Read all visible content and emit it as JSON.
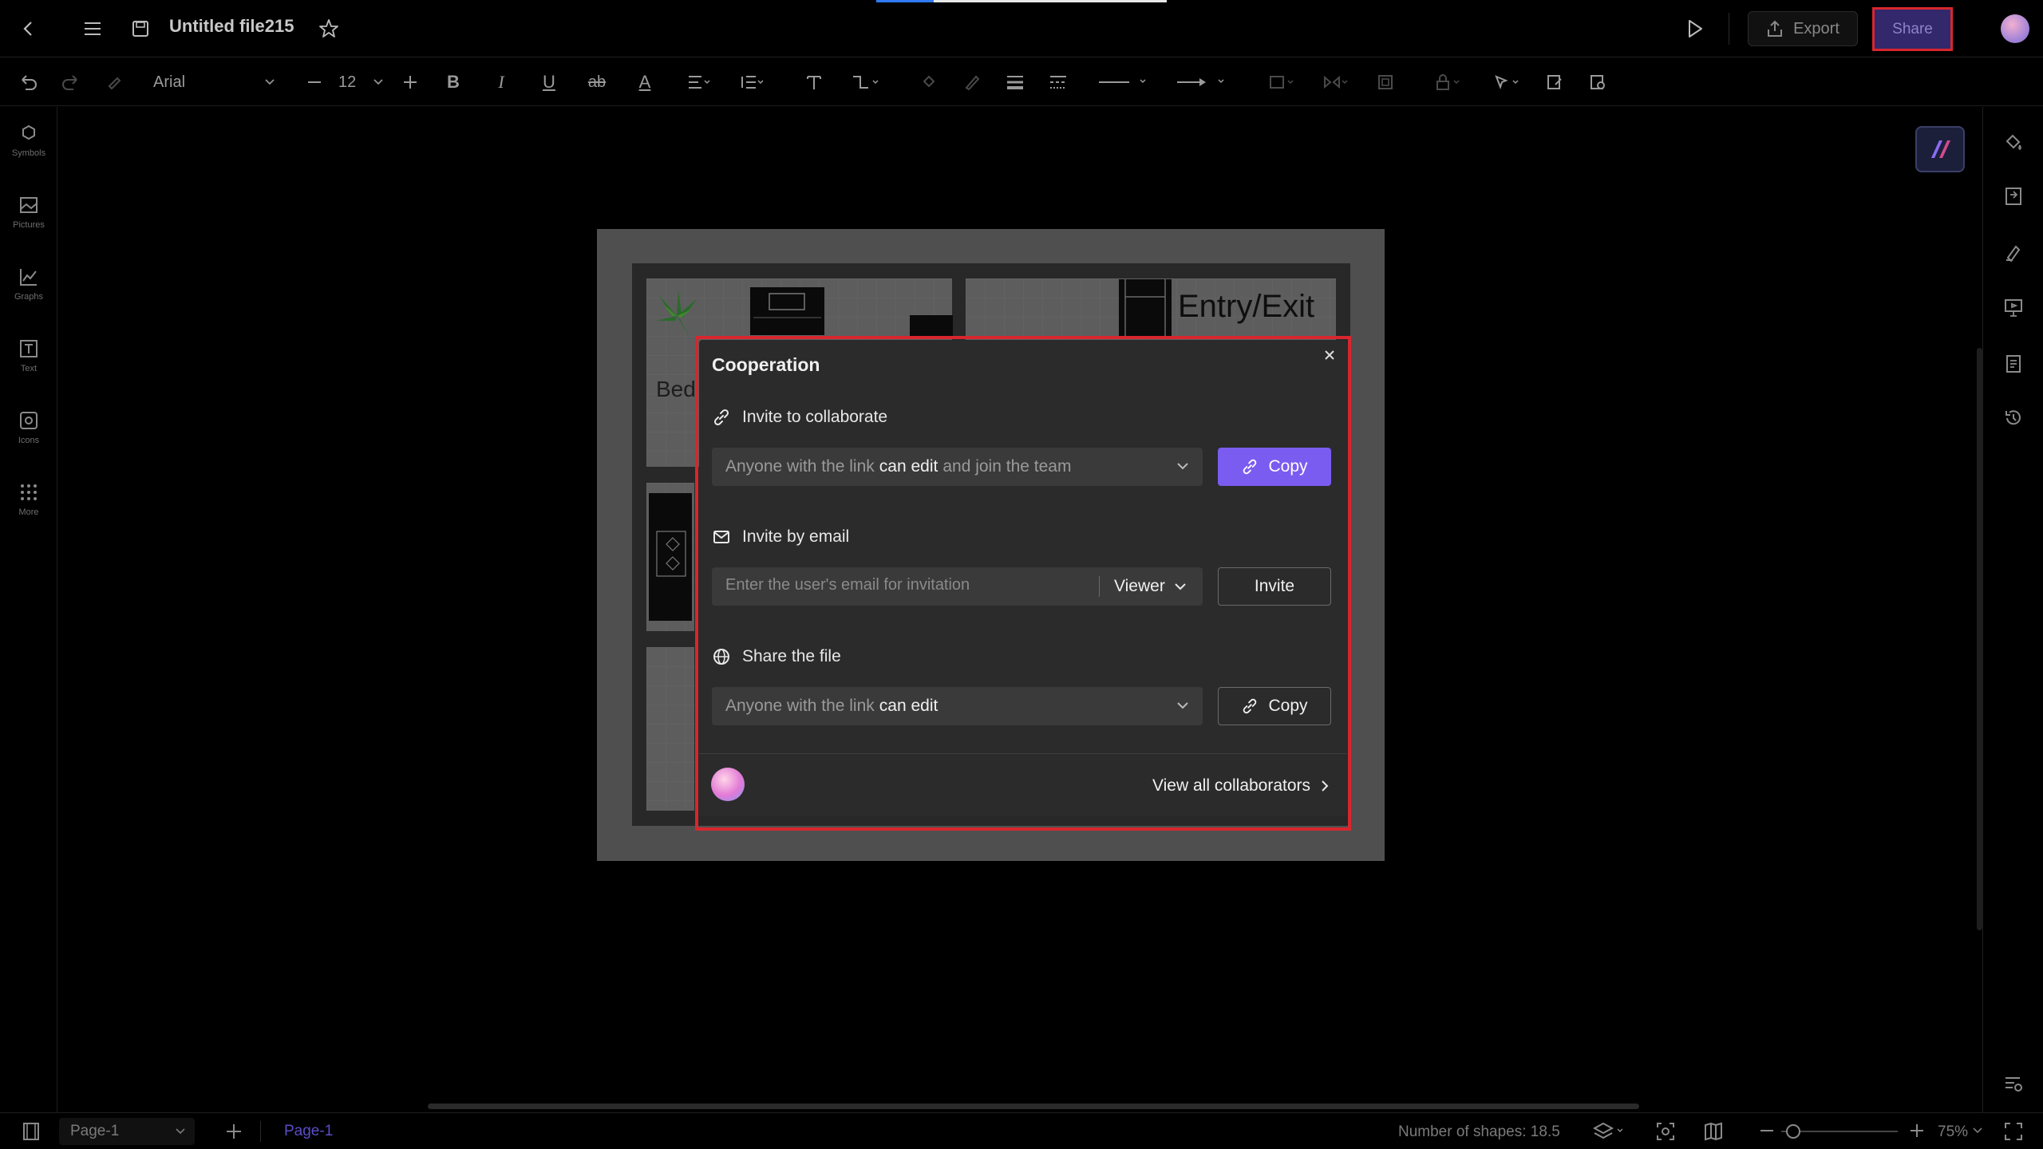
{
  "topbar": {
    "file_title": "Untitled file215",
    "export_label": "Export",
    "share_label": "Share"
  },
  "toolbar": {
    "font_family": "Arial",
    "font_size": "12",
    "strike_label": "ab"
  },
  "left_sidebar": {
    "items": [
      {
        "label": "Symbols",
        "icon": "symbols-icon"
      },
      {
        "label": "Pictures",
        "icon": "pictures-icon"
      },
      {
        "label": "Graphs",
        "icon": "graphs-icon"
      },
      {
        "label": "Text",
        "icon": "text-icon"
      },
      {
        "label": "Icons",
        "icon": "icons-icon"
      },
      {
        "label": "More",
        "icon": "more-grid-icon"
      }
    ]
  },
  "canvas": {
    "entry_exit_label": "Entry/Exit",
    "bed_label": "Bed"
  },
  "dialog": {
    "title": "Cooperation",
    "invite_collab": {
      "heading": "Invite to collaborate",
      "select_prefix": "Anyone with the link",
      "select_strong": "can edit",
      "select_suffix": "and join the team",
      "copy_label": "Copy"
    },
    "invite_email": {
      "heading": "Invite by email",
      "placeholder": "Enter the user's email for invitation",
      "role": "Viewer",
      "invite_label": "Invite"
    },
    "share_file": {
      "heading": "Share the file",
      "select_prefix": "Anyone with the link",
      "select_strong": "can edit",
      "copy_label": "Copy"
    },
    "view_all_label": "View all collaborators"
  },
  "statusbar": {
    "page_dropdown": "Page-1",
    "page_tab": "Page-1",
    "shapes_count": "Number of shapes: 18.5",
    "zoom": "75%"
  },
  "colors": {
    "accent": "#7b5cf0",
    "highlight": "#d8262e",
    "share_bg": "#33286b"
  }
}
